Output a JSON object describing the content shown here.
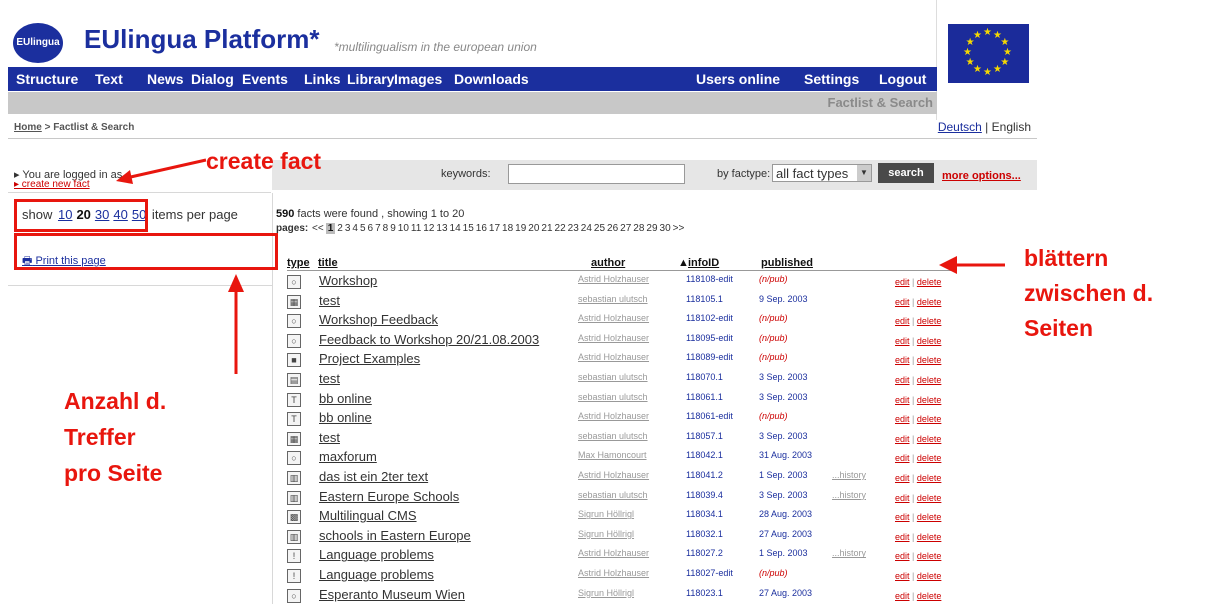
{
  "header": {
    "logo_text": "EUlingua",
    "brand_title": "EUlingua Platform*",
    "tagline": "*multilingualism in the european union"
  },
  "nav": {
    "items": [
      "Structure",
      "Text",
      "News",
      "Dialog",
      "Events",
      "Links",
      "Library",
      "Images",
      "Downloads"
    ],
    "right": [
      "Users online",
      "Settings",
      "Logout"
    ],
    "sub_title": "Factlist & Search"
  },
  "breadcrumb": {
    "home": "Home",
    "sep": " > ",
    "current": "Factlist & Search"
  },
  "lang": {
    "deutsch": "Deutsch",
    "sep": " | ",
    "english": "English"
  },
  "left": {
    "logged_in": "▸ You are logged in as",
    "create_link": "▸ create new fact",
    "ipp_prefix": "show",
    "ipp_options": [
      "10",
      "20",
      "30",
      "40",
      "50"
    ],
    "ipp_current": "20",
    "ipp_suffix": "items per page",
    "print_label": "Print this page"
  },
  "search": {
    "keywords_label": "keywords:",
    "keywords_value": "",
    "factype_label": "by factype:",
    "factype_value": "all fact types",
    "search_button": "search",
    "more_options": "more options..."
  },
  "results": {
    "count": "590",
    "found_text": " facts were found , showing 1 to 20",
    "pages_label": "pages:",
    "pages_prev": "<<",
    "pages": [
      "1",
      "2",
      "3",
      "4",
      "5",
      "6",
      "7",
      "8",
      "9",
      "10",
      "11",
      "12",
      "13",
      "14",
      "15",
      "16",
      "17",
      "18",
      "19",
      "20",
      "21",
      "22",
      "23",
      "24",
      "25",
      "26",
      "27",
      "28",
      "29",
      "30"
    ],
    "pages_next": ">>",
    "current_page": "1"
  },
  "table": {
    "headers": {
      "type": "type",
      "title": "title",
      "author": "author",
      "infoid": "infoID",
      "published": "published"
    },
    "sort_marker": "▲",
    "edit_label": "edit",
    "delete_label": "delete",
    "rows": [
      {
        "icon": "speech-bubble-icon",
        "glyph": "○",
        "title": "Workshop",
        "author": "Astrid Holzhauser",
        "infoid": "118108-edit",
        "published": "(n/pub)",
        "history": ""
      },
      {
        "icon": "grid-icon",
        "glyph": "▦",
        "title": "test",
        "author": "sebastian ulutsch",
        "infoid": "118105.1",
        "published": "9 Sep. 2003",
        "history": ""
      },
      {
        "icon": "speech-bubble-icon",
        "glyph": "○",
        "title": "Workshop Feedback",
        "author": "Astrid Holzhauser",
        "infoid": "118102-edit",
        "published": "(n/pub)",
        "history": ""
      },
      {
        "icon": "speech-bubble-icon",
        "glyph": "○",
        "title": "Feedback to Workshop 20/21.08.2003",
        "author": "Astrid Holzhauser",
        "infoid": "118095-edit",
        "published": "(n/pub)",
        "history": ""
      },
      {
        "icon": "project-icon",
        "glyph": "■",
        "title": "Project Examples",
        "author": "Astrid Holzhauser",
        "infoid": "118089-edit",
        "published": "(n/pub)",
        "history": ""
      },
      {
        "icon": "document-icon",
        "glyph": "▤",
        "title": "test",
        "author": "sebastian ulutsch",
        "infoid": "118070.1",
        "published": "3 Sep. 2003",
        "history": ""
      },
      {
        "icon": "text-icon",
        "glyph": "T",
        "title": "bb online",
        "author": "sebastian ulutsch",
        "infoid": "118061.1",
        "published": "3 Sep. 2003",
        "history": ""
      },
      {
        "icon": "text-icon",
        "glyph": "T",
        "title": "bb online",
        "author": "Astrid Holzhauser",
        "infoid": "118061-edit",
        "published": "(n/pub)",
        "history": ""
      },
      {
        "icon": "grid-icon",
        "glyph": "▦",
        "title": "test",
        "author": "sebastian ulutsch",
        "infoid": "118057.1",
        "published": "3 Sep. 2003",
        "history": ""
      },
      {
        "icon": "speech-bubble-icon",
        "glyph": "○",
        "title": "maxforum",
        "author": "Max Hamoncourt",
        "infoid": "118042.1",
        "published": "31 Aug. 2003",
        "history": ""
      },
      {
        "icon": "book-icon",
        "glyph": "▥",
        "title": "das ist ein 2ter text",
        "author": "Astrid Holzhauser",
        "infoid": "118041.2",
        "published": "1 Sep. 2003",
        "history": "history"
      },
      {
        "icon": "book-icon",
        "glyph": "▥",
        "title": "Eastern Europe Schools",
        "author": "sebastian ulutsch",
        "infoid": "118039.4",
        "published": "3 Sep. 2003",
        "history": "history"
      },
      {
        "icon": "cms-icon",
        "glyph": "▩",
        "title": "Multilingual CMS",
        "author": "Sigrun Höllrigl",
        "infoid": "118034.1",
        "published": "28 Aug. 2003",
        "history": ""
      },
      {
        "icon": "book-icon",
        "glyph": "▥",
        "title": "schools in Eastern Europe",
        "author": "Sigrun Höllrigl",
        "infoid": "118032.1",
        "published": "27 Aug. 2003",
        "history": ""
      },
      {
        "icon": "problem-icon",
        "glyph": "!",
        "title": "Language problems",
        "author": "Astrid Holzhauser",
        "infoid": "118027.2",
        "published": "1 Sep. 2003",
        "history": "history"
      },
      {
        "icon": "problem-icon",
        "glyph": "!",
        "title": "Language problems",
        "author": "Astrid Holzhauser",
        "infoid": "118027-edit",
        "published": "(n/pub)",
        "history": ""
      },
      {
        "icon": "speech-bubble-icon",
        "glyph": "○",
        "title": "Esperanto Museum Wien",
        "author": "Sigrun Höllrigl",
        "infoid": "118023.1",
        "published": "27 Aug. 2003",
        "history": ""
      }
    ]
  },
  "annotations": {
    "create_fact": "create fact",
    "paging": [
      "blättern",
      "zwischen d.",
      "Seiten"
    ],
    "per_page": [
      "Anzahl d.",
      "Treffer",
      "pro Seite"
    ],
    "color": "#e8160e"
  }
}
